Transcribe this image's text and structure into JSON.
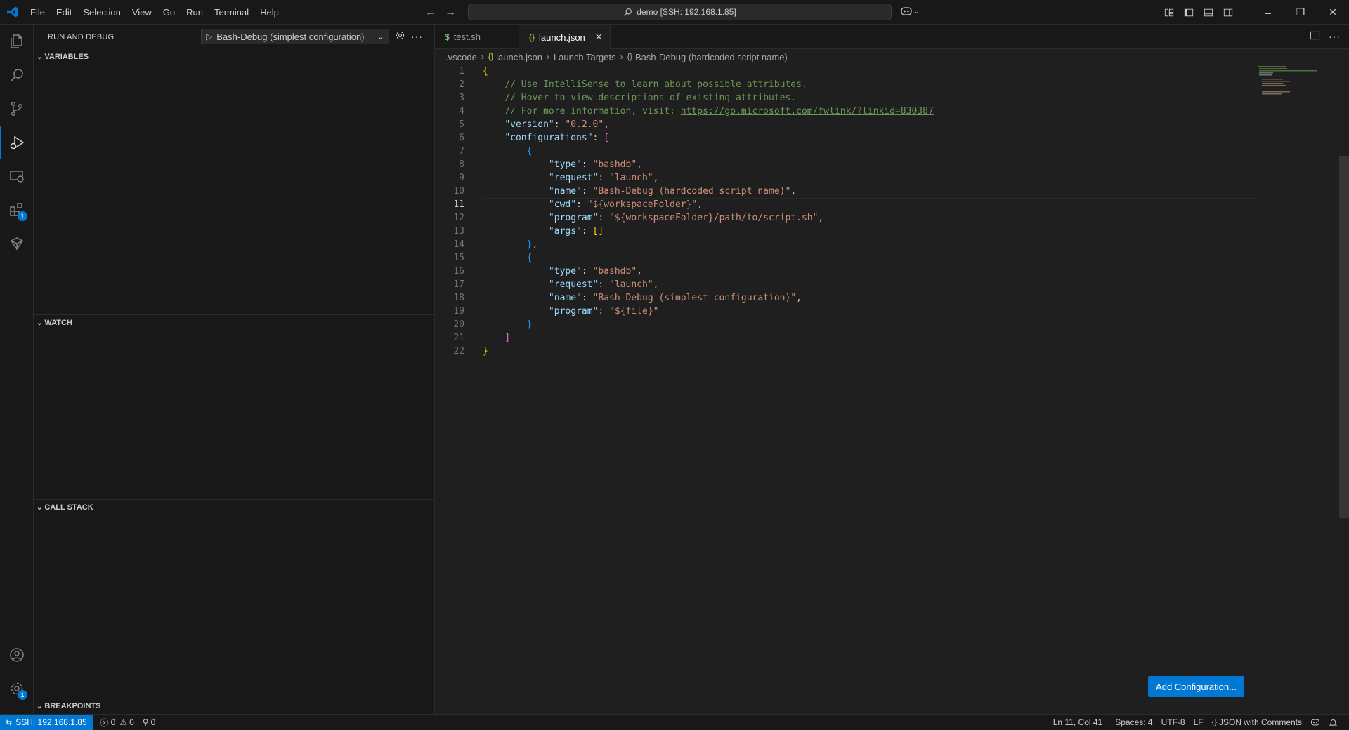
{
  "titlebar": {
    "menu": [
      "File",
      "Edit",
      "Selection",
      "View",
      "Go",
      "Run",
      "Terminal",
      "Help"
    ],
    "command_center": "demo [SSH: 192.168.1.85]"
  },
  "activity": {
    "extensions_badge": "1",
    "settings_badge": "1"
  },
  "sidebar": {
    "title": "RUN AND DEBUG",
    "debug_config": "Bash-Debug (simplest configuration)",
    "sections": {
      "variables": "VARIABLES",
      "watch": "WATCH",
      "call_stack": "CALL STACK",
      "breakpoints": "BREAKPOINTS"
    }
  },
  "tabs": [
    {
      "label": "test.sh",
      "icon": "$"
    },
    {
      "label": "launch.json",
      "icon": "{}"
    }
  ],
  "breadcrumbs": [
    ".vscode",
    "launch.json",
    "Launch Targets",
    "Bash-Debug (hardcoded script name)"
  ],
  "code": {
    "comment1": "// Use IntelliSense to learn about possible attributes.",
    "comment2": "// Hover to view descriptions of existing attributes.",
    "comment3_prefix": "// For more information, visit: ",
    "comment3_link": "https://go.microsoft.com/fwlink/?linkid=830387",
    "version_key": "\"version\"",
    "version_val": "\"0.2.0\"",
    "configs_key": "\"configurations\"",
    "type_key": "\"type\"",
    "type_val": "\"bashdb\"",
    "request_key": "\"request\"",
    "request_val": "\"launch\"",
    "name_key": "\"name\"",
    "name1_val": "\"Bash-Debug (hardcoded script name)\"",
    "cwd_key": "\"cwd\"",
    "cwd_val": "\"${workspaceFolder}\"",
    "program_key": "\"program\"",
    "program1_val": "\"${workspaceFolder}/path/to/script.sh\"",
    "args_key": "\"args\"",
    "name2_val": "\"Bash-Debug (simplest configuration)\"",
    "program2_val": "\"${file}\""
  },
  "add_configuration": "Add Configuration...",
  "status": {
    "remote": "SSH: 192.168.1.85",
    "errors": "0",
    "warnings": "0",
    "ports": "0",
    "position": "Ln 11, Col 41",
    "spaces": "Spaces: 4",
    "encoding": "UTF-8",
    "eol": "LF",
    "language": "JSON with Comments"
  }
}
